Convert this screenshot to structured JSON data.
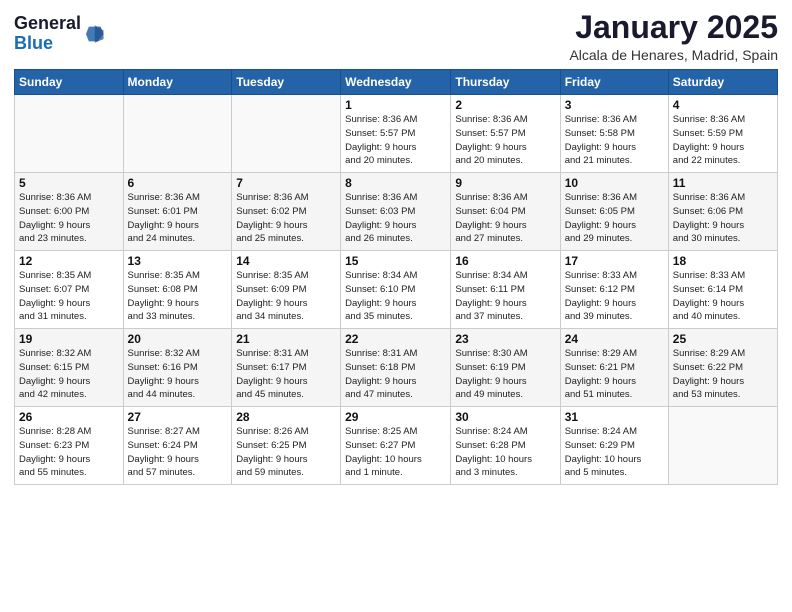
{
  "header": {
    "logo_line1": "General",
    "logo_line2": "Blue",
    "month": "January 2025",
    "location": "Alcala de Henares, Madrid, Spain"
  },
  "weekdays": [
    "Sunday",
    "Monday",
    "Tuesday",
    "Wednesday",
    "Thursday",
    "Friday",
    "Saturday"
  ],
  "weeks": [
    [
      {
        "day": "",
        "info": ""
      },
      {
        "day": "",
        "info": ""
      },
      {
        "day": "",
        "info": ""
      },
      {
        "day": "1",
        "info": "Sunrise: 8:36 AM\nSunset: 5:57 PM\nDaylight: 9 hours\nand 20 minutes."
      },
      {
        "day": "2",
        "info": "Sunrise: 8:36 AM\nSunset: 5:57 PM\nDaylight: 9 hours\nand 20 minutes."
      },
      {
        "day": "3",
        "info": "Sunrise: 8:36 AM\nSunset: 5:58 PM\nDaylight: 9 hours\nand 21 minutes."
      },
      {
        "day": "4",
        "info": "Sunrise: 8:36 AM\nSunset: 5:59 PM\nDaylight: 9 hours\nand 22 minutes."
      }
    ],
    [
      {
        "day": "5",
        "info": "Sunrise: 8:36 AM\nSunset: 6:00 PM\nDaylight: 9 hours\nand 23 minutes."
      },
      {
        "day": "6",
        "info": "Sunrise: 8:36 AM\nSunset: 6:01 PM\nDaylight: 9 hours\nand 24 minutes."
      },
      {
        "day": "7",
        "info": "Sunrise: 8:36 AM\nSunset: 6:02 PM\nDaylight: 9 hours\nand 25 minutes."
      },
      {
        "day": "8",
        "info": "Sunrise: 8:36 AM\nSunset: 6:03 PM\nDaylight: 9 hours\nand 26 minutes."
      },
      {
        "day": "9",
        "info": "Sunrise: 8:36 AM\nSunset: 6:04 PM\nDaylight: 9 hours\nand 27 minutes."
      },
      {
        "day": "10",
        "info": "Sunrise: 8:36 AM\nSunset: 6:05 PM\nDaylight: 9 hours\nand 29 minutes."
      },
      {
        "day": "11",
        "info": "Sunrise: 8:36 AM\nSunset: 6:06 PM\nDaylight: 9 hours\nand 30 minutes."
      }
    ],
    [
      {
        "day": "12",
        "info": "Sunrise: 8:35 AM\nSunset: 6:07 PM\nDaylight: 9 hours\nand 31 minutes."
      },
      {
        "day": "13",
        "info": "Sunrise: 8:35 AM\nSunset: 6:08 PM\nDaylight: 9 hours\nand 33 minutes."
      },
      {
        "day": "14",
        "info": "Sunrise: 8:35 AM\nSunset: 6:09 PM\nDaylight: 9 hours\nand 34 minutes."
      },
      {
        "day": "15",
        "info": "Sunrise: 8:34 AM\nSunset: 6:10 PM\nDaylight: 9 hours\nand 35 minutes."
      },
      {
        "day": "16",
        "info": "Sunrise: 8:34 AM\nSunset: 6:11 PM\nDaylight: 9 hours\nand 37 minutes."
      },
      {
        "day": "17",
        "info": "Sunrise: 8:33 AM\nSunset: 6:12 PM\nDaylight: 9 hours\nand 39 minutes."
      },
      {
        "day": "18",
        "info": "Sunrise: 8:33 AM\nSunset: 6:14 PM\nDaylight: 9 hours\nand 40 minutes."
      }
    ],
    [
      {
        "day": "19",
        "info": "Sunrise: 8:32 AM\nSunset: 6:15 PM\nDaylight: 9 hours\nand 42 minutes."
      },
      {
        "day": "20",
        "info": "Sunrise: 8:32 AM\nSunset: 6:16 PM\nDaylight: 9 hours\nand 44 minutes."
      },
      {
        "day": "21",
        "info": "Sunrise: 8:31 AM\nSunset: 6:17 PM\nDaylight: 9 hours\nand 45 minutes."
      },
      {
        "day": "22",
        "info": "Sunrise: 8:31 AM\nSunset: 6:18 PM\nDaylight: 9 hours\nand 47 minutes."
      },
      {
        "day": "23",
        "info": "Sunrise: 8:30 AM\nSunset: 6:19 PM\nDaylight: 9 hours\nand 49 minutes."
      },
      {
        "day": "24",
        "info": "Sunrise: 8:29 AM\nSunset: 6:21 PM\nDaylight: 9 hours\nand 51 minutes."
      },
      {
        "day": "25",
        "info": "Sunrise: 8:29 AM\nSunset: 6:22 PM\nDaylight: 9 hours\nand 53 minutes."
      }
    ],
    [
      {
        "day": "26",
        "info": "Sunrise: 8:28 AM\nSunset: 6:23 PM\nDaylight: 9 hours\nand 55 minutes."
      },
      {
        "day": "27",
        "info": "Sunrise: 8:27 AM\nSunset: 6:24 PM\nDaylight: 9 hours\nand 57 minutes."
      },
      {
        "day": "28",
        "info": "Sunrise: 8:26 AM\nSunset: 6:25 PM\nDaylight: 9 hours\nand 59 minutes."
      },
      {
        "day": "29",
        "info": "Sunrise: 8:25 AM\nSunset: 6:27 PM\nDaylight: 10 hours\nand 1 minute."
      },
      {
        "day": "30",
        "info": "Sunrise: 8:24 AM\nSunset: 6:28 PM\nDaylight: 10 hours\nand 3 minutes."
      },
      {
        "day": "31",
        "info": "Sunrise: 8:24 AM\nSunset: 6:29 PM\nDaylight: 10 hours\nand 5 minutes."
      },
      {
        "day": "",
        "info": ""
      }
    ]
  ]
}
